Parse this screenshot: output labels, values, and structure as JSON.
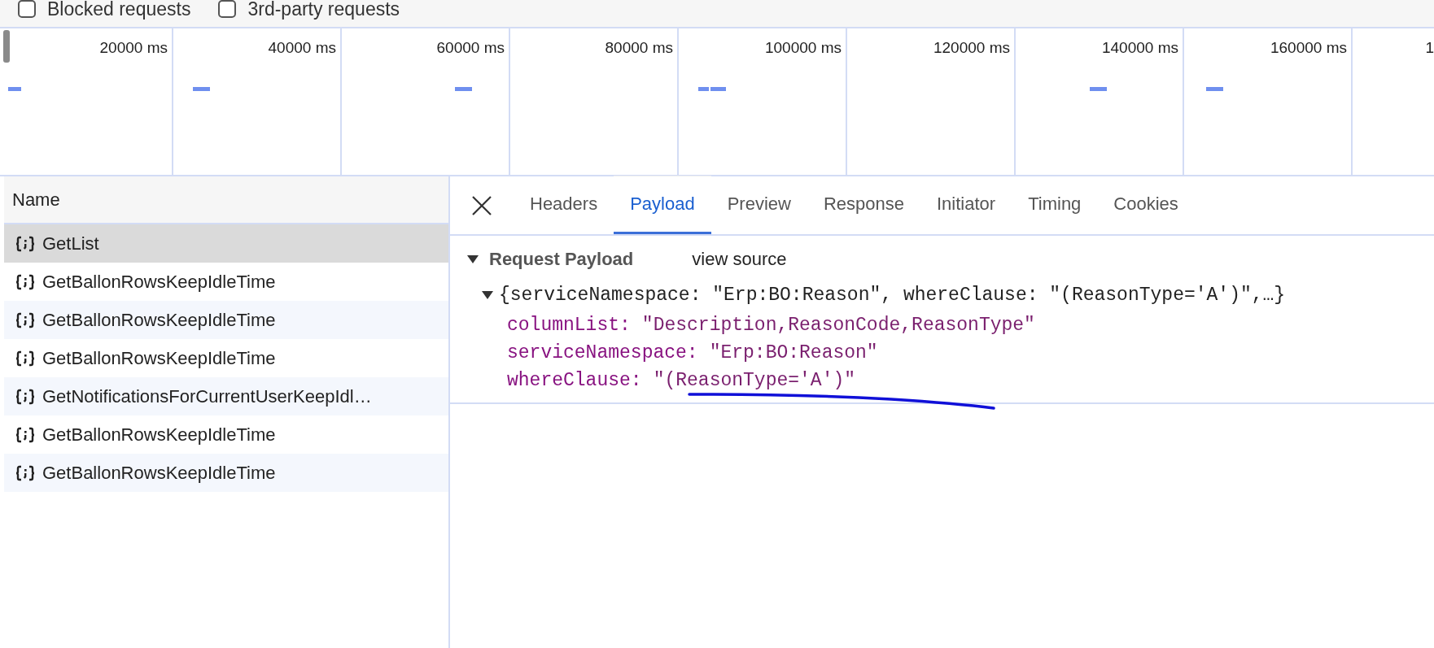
{
  "filters": [
    {
      "label": "Blocked requests",
      "checked": false
    },
    {
      "label": "3rd-party requests",
      "checked": false
    }
  ],
  "timeline": {
    "ticks": [
      "20000 ms",
      "40000 ms",
      "60000 ms",
      "80000 ms",
      "100000 ms",
      "120000 ms",
      "140000 ms",
      "160000 ms",
      "1"
    ]
  },
  "requests": {
    "column": "Name",
    "rows": [
      {
        "name": "GetList",
        "selected": true
      },
      {
        "name": "GetBallonRowsKeepIdleTime",
        "selected": false
      },
      {
        "name": "GetBallonRowsKeepIdleTime",
        "selected": false
      },
      {
        "name": "GetBallonRowsKeepIdleTime",
        "selected": false
      },
      {
        "name": "GetNotificationsForCurrentUserKeepIdl…",
        "selected": false
      },
      {
        "name": "GetBallonRowsKeepIdleTime",
        "selected": false
      },
      {
        "name": "GetBallonRowsKeepIdleTime",
        "selected": false
      }
    ]
  },
  "tabs": [
    {
      "label": "Headers",
      "selected": false
    },
    {
      "label": "Payload",
      "selected": true
    },
    {
      "label": "Preview",
      "selected": false
    },
    {
      "label": "Response",
      "selected": false
    },
    {
      "label": "Initiator",
      "selected": false
    },
    {
      "label": "Timing",
      "selected": false
    },
    {
      "label": "Cookies",
      "selected": false
    }
  ],
  "payload": {
    "title": "Request Payload",
    "expanded": true,
    "view_source": "view source",
    "object": {
      "summary": "{serviceNamespace: \"Erp:BO:Reason\", whereClause: \"(ReasonType='A')\",…}",
      "expanded": true,
      "properties": [
        {
          "key": "columnList:",
          "value": "\"Description,ReasonCode,ReasonType\""
        },
        {
          "key": "serviceNamespace:",
          "value": "\"Erp:BO:Reason\""
        },
        {
          "key": "whereClause:",
          "value": "\"(ReasonType='A')\""
        }
      ]
    }
  }
}
